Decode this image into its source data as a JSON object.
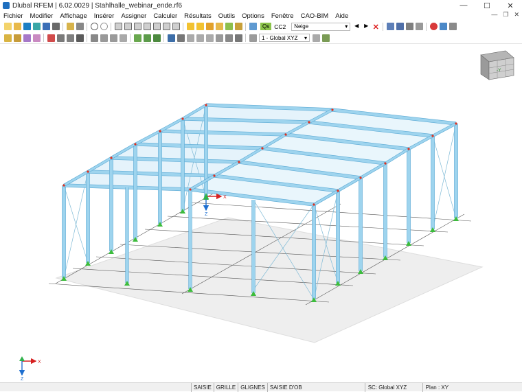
{
  "window": {
    "title": "Dlubal RFEM | 6.02.0029 | Stahlhalle_webinar_ende.rf6"
  },
  "menu": [
    "Fichier",
    "Modifier",
    "Affichage",
    "Insérer",
    "Assigner",
    "Calculer",
    "Résultats",
    "Outils",
    "Options",
    "Fenêtre",
    "CAO-BIM",
    "Aide"
  ],
  "toolbar": {
    "load_badge": "Qs",
    "load_code": "CC2",
    "load_case": "Neige",
    "view_select": "1 - Global XYZ"
  },
  "viewcube": {
    "face_label": "-Y"
  },
  "origin_axes": {
    "x": "X",
    "z": "Z"
  },
  "corner_axes": {
    "x": "X",
    "z": "Z"
  },
  "statusbar": {
    "buttons": [
      "SAISIE",
      "GRILLE",
      "GLIGNES",
      "SAISIE D'OB"
    ],
    "coord_system": "SC: Global XYZ",
    "plane": "Plan : XY"
  },
  "colors": {
    "member": "#9ed4ee",
    "member_edge": "#5aa9d4",
    "bracing": "#7fbad6",
    "support": "#3cbc3c",
    "node": "#e0301e",
    "ground": "#eeeeee",
    "gridline": "#555555"
  }
}
